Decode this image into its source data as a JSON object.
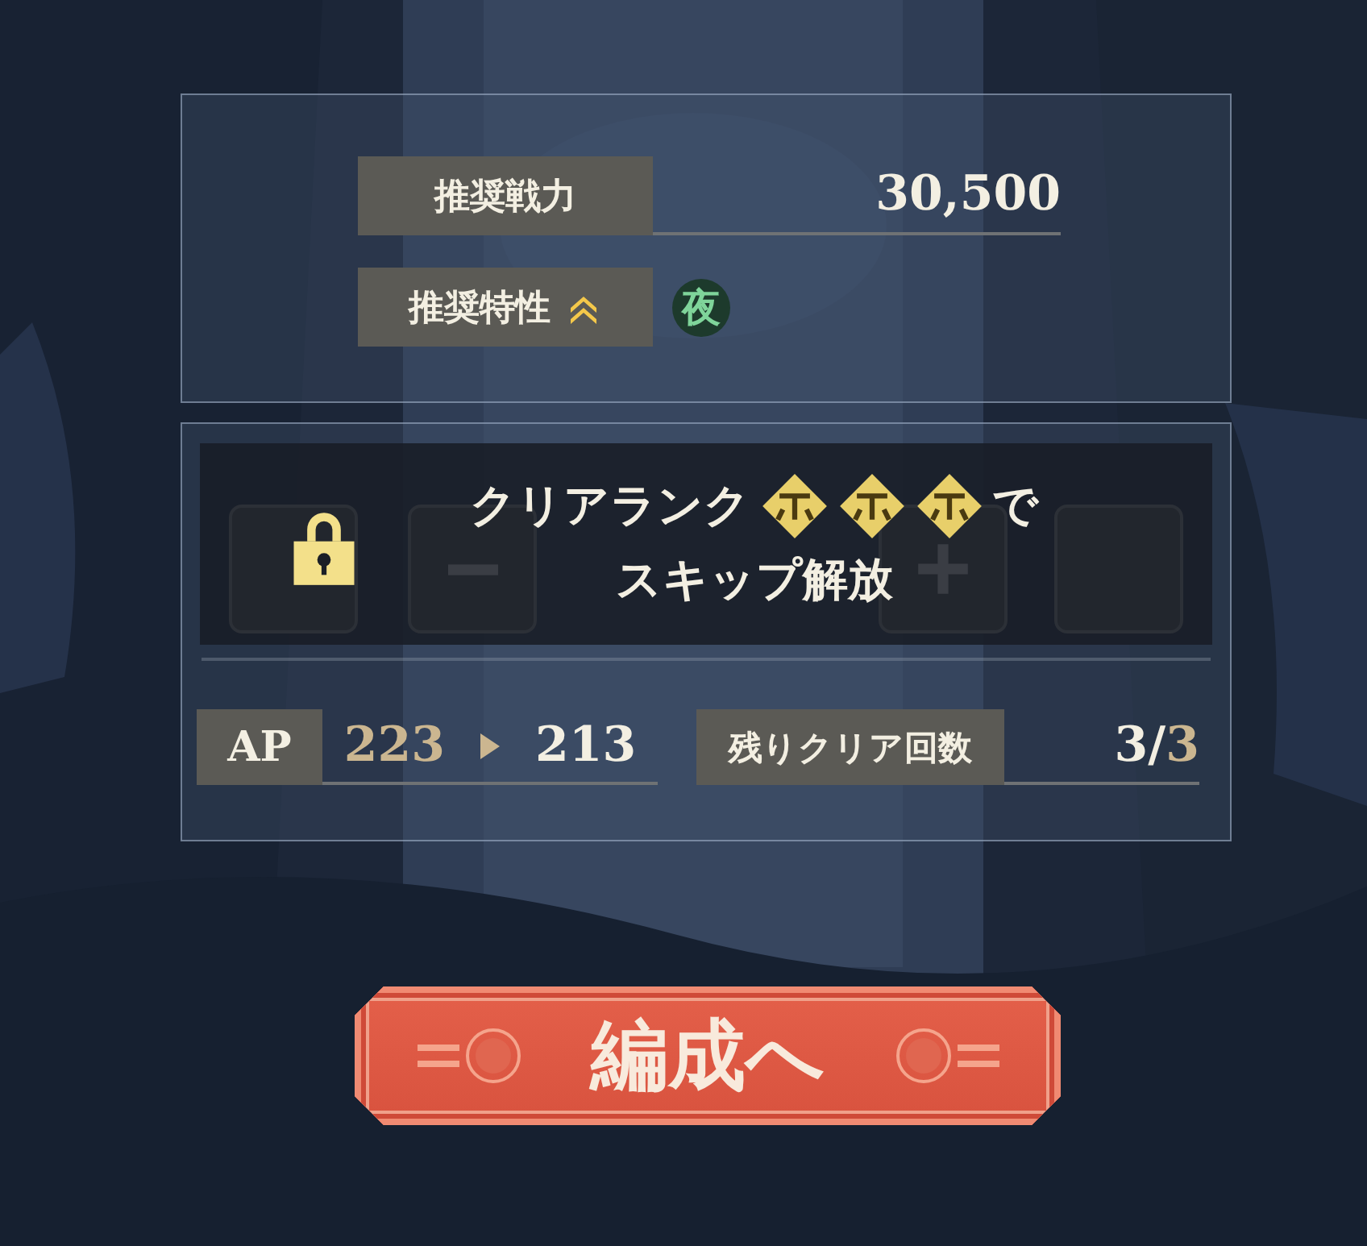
{
  "recommendation": {
    "power_label": "推奨戦力",
    "power_value": "30,500",
    "trait_label": "推奨特性",
    "trait_badge": "夜"
  },
  "skip_lock": {
    "line_1_before": "クリアランク",
    "line_1_after": "で",
    "line_2": "スキップ解放"
  },
  "stats": {
    "ap_label": "AP",
    "ap_before": "223",
    "ap_after": "213",
    "clears_label": "残りクリア回数",
    "clears_value": "3/3"
  },
  "formation_button": {
    "label": "編成へ"
  }
}
